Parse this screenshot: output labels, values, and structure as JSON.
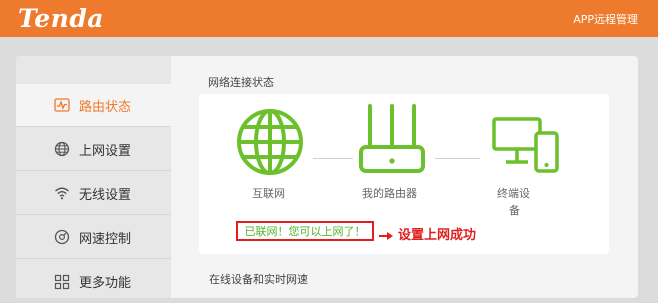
{
  "header": {
    "logo": "Tenda",
    "app_link": "APP远程管理"
  },
  "sidebar": {
    "items": [
      {
        "label": "路由状态",
        "icon": "pulse-monitor-icon",
        "active": true
      },
      {
        "label": "上网设置",
        "icon": "globe-icon",
        "active": false
      },
      {
        "label": "无线设置",
        "icon": "wifi-icon",
        "active": false
      },
      {
        "label": "网速控制",
        "icon": "speedometer-icon",
        "active": false
      },
      {
        "label": "更多功能",
        "icon": "grid-icon",
        "active": false
      }
    ]
  },
  "main": {
    "section_title": "网络连接状态",
    "nodes": {
      "internet": "互联网",
      "router": "我的路由器",
      "terminal_line1": "终端设",
      "terminal_line2": "备"
    },
    "status_text": "已联网！您可以上网了！",
    "annotation": "设置上网成功",
    "section2_title": "在线设备和实时网速"
  },
  "colors": {
    "brand": "#ee7a2d",
    "status_green": "#52b32c",
    "annotation_red": "#e02020"
  }
}
